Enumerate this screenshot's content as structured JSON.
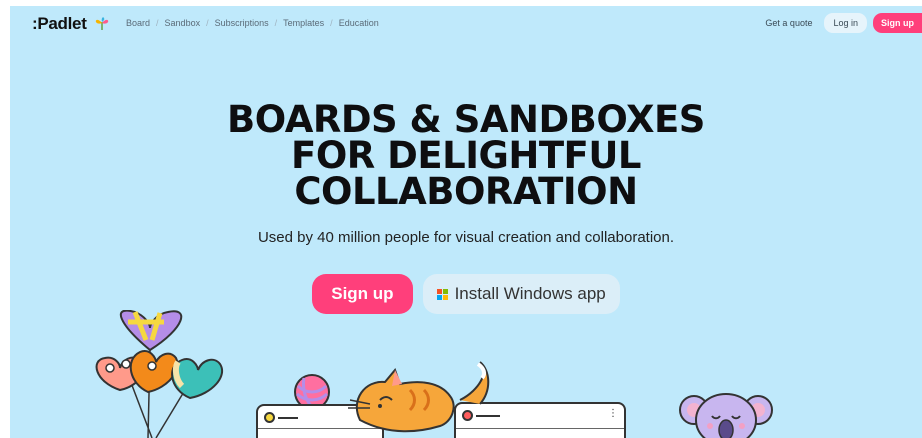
{
  "nav": {
    "logo": ":Padlet",
    "links": [
      "Board",
      "Sandbox",
      "Subscriptions",
      "Templates",
      "Education"
    ],
    "get_quote": "Get a quote",
    "login": "Log in",
    "signup": "Sign up"
  },
  "hero": {
    "headline_1": "BOARDS & SANDBOXES",
    "headline_2": "FOR DELIGHTFUL",
    "headline_3": "COLLABORATION",
    "subtitle": "Used by 40 million people for visual creation and collaboration.",
    "signup_button": "Sign up",
    "install_button": "Install Windows app"
  },
  "colors": {
    "background": "#bfe9fb",
    "accent": "#ff3f7b"
  }
}
